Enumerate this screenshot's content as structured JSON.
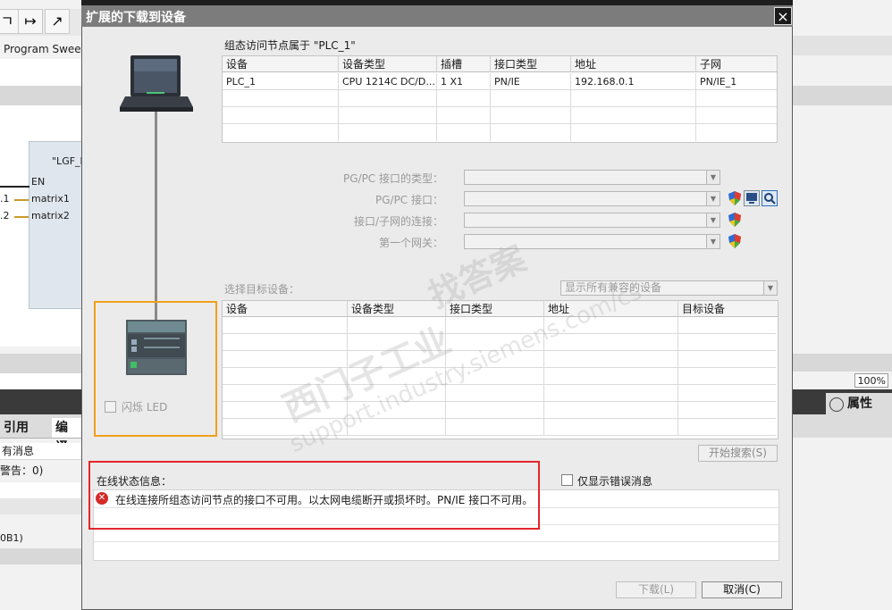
{
  "background": {
    "toolbar": {
      "step_into_icon": "↦",
      "step_out_icon": "↗",
      "first_char": "ㄱ"
    },
    "program_sweep": "Program Sweep",
    "fb_title": "\"LGF_I",
    "pins": {
      "en": "EN",
      "matrix1": "matrix1",
      "matrix2": "matrix2",
      "num1": ".1",
      "num2": ".2"
    },
    "tabs": {
      "ref": "引用",
      "compile": "编译"
    },
    "rows": {
      "all_msgs": "有消息",
      "warnings": "警告：0)",
      "ob1": "0B1)"
    },
    "zoom": "100%",
    "properties": "属性"
  },
  "dialog": {
    "title": "扩展的下载到设备",
    "close": "×",
    "access_node_caption": "组态访问节点属于 \"PLC_1\"",
    "config_table": {
      "headers": [
        "设备",
        "设备类型",
        "插槽",
        "接口类型",
        "地址",
        "子网"
      ],
      "rows": [
        [
          "PLC_1",
          "CPU 1214C DC/D...",
          "1 X1",
          "PN/IE",
          "192.168.0.1",
          "PN/IE_1"
        ]
      ]
    },
    "interface_form": {
      "pgpc_type_label": "PG/PC 接口的类型：",
      "pgpc_interface_label": "PG/PC 接口：",
      "subnet_conn_label": "接口/子网的连接：",
      "first_gateway_label": "第一个网关："
    },
    "select_target_label": "选择目标设备：",
    "show_filter": "显示所有兼容的设备",
    "target_table": {
      "headers": [
        "设备",
        "设备类型",
        "接口类型",
        "地址",
        "目标设备"
      ]
    },
    "flash_led": "闪烁 LED",
    "start_search": "开始搜索(S)",
    "status": {
      "title": "在线状态信息：",
      "message": "在线连接所组态访问节点的接口不可用。以太网电缆断开或损坏时。PN/IE 接口不可用。",
      "errors_only": "仅显示错误消息"
    },
    "buttons": {
      "download": "下载(L)",
      "cancel": "取消(C)"
    },
    "watermark": {
      "line1": "西门子工业",
      "line2": "support.industry.siemens.com/cs",
      "line3": "找答案"
    }
  },
  "colors": {
    "highlight_orange": "#f0a01a",
    "highlight_red": "#e3262c",
    "error_icon": "#d42a2a"
  }
}
